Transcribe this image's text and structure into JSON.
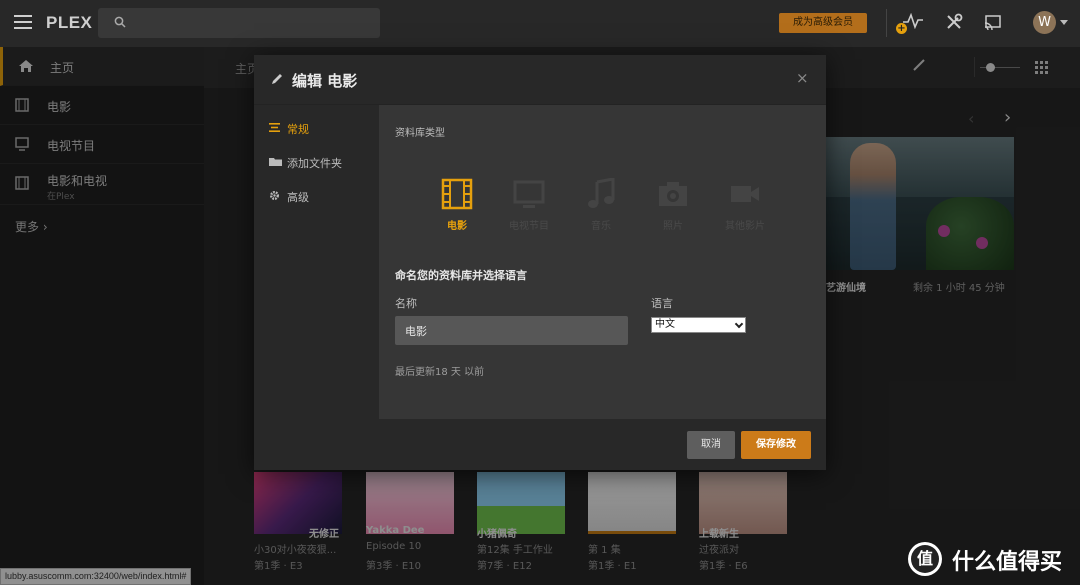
{
  "topbar": {
    "logo_main": "PLEX",
    "premium_button": "成为高级会员",
    "avatar_initial": "W",
    "activity_badge": "+"
  },
  "sidebar": {
    "items": [
      {
        "label": "主页",
        "icon": "home-icon"
      },
      {
        "label": "电影",
        "icon": "film-icon"
      },
      {
        "label": "电视节目",
        "icon": "tv-icon"
      },
      {
        "label": "电影和电视",
        "sublabel": "在Plex",
        "icon": "film-icon"
      }
    ],
    "more": "更多"
  },
  "main": {
    "breadcrumb": "主页",
    "hero": {
      "title": "艺游仙境",
      "time_left": "剩余 1 小时 45 分钟"
    },
    "posters": [
      {
        "title": "无修正",
        "line1": "小30对小夜夜狠...",
        "line2": "第1季 · E3"
      },
      {
        "title": "Yakka Dee",
        "line1": "Episode 10",
        "line2": "第3季 · E10"
      },
      {
        "title": "小猪佩奇",
        "line1": "第12集 手工作业",
        "line2": "第7季 · E12"
      },
      {
        "title": "",
        "line1": "第 1 集",
        "line2": "第1季 · E1"
      },
      {
        "title": "上载新生",
        "line1": "过夜派对",
        "line2": "第1季 · E6"
      }
    ]
  },
  "status_url": "lubby.asuscomm.com:32400/web/index.html#",
  "watermark": {
    "logo": "值",
    "text": "什么值得买"
  },
  "modal": {
    "title": "编辑 电影",
    "close": "×",
    "nav": [
      {
        "label": "常规",
        "icon": "list-icon",
        "active": true
      },
      {
        "label": "添加文件夹",
        "icon": "folder-icon",
        "active": false
      },
      {
        "label": "高级",
        "icon": "gear-icon",
        "active": false
      }
    ],
    "library_type_label": "资料库类型",
    "library_types": [
      {
        "label": "电影",
        "icon": "film-icon",
        "selected": true
      },
      {
        "label": "电视节目",
        "icon": "tv-icon",
        "selected": false
      },
      {
        "label": "音乐",
        "icon": "music-icon",
        "selected": false
      },
      {
        "label": "照片",
        "icon": "camera-icon",
        "selected": false
      },
      {
        "label": "其他影片",
        "icon": "video-camera-icon",
        "selected": false
      }
    ],
    "name_section": "命名您的资料库并选择语言",
    "name_label": "名称",
    "name_value": "电影",
    "language_label": "语言",
    "language_value": "中文",
    "last_updated": "最后更新18 天 以前",
    "cancel_button": "取消",
    "save_button": "保存修改"
  },
  "colors": {
    "accent": "#e5a00d",
    "save": "#cc7b19"
  }
}
